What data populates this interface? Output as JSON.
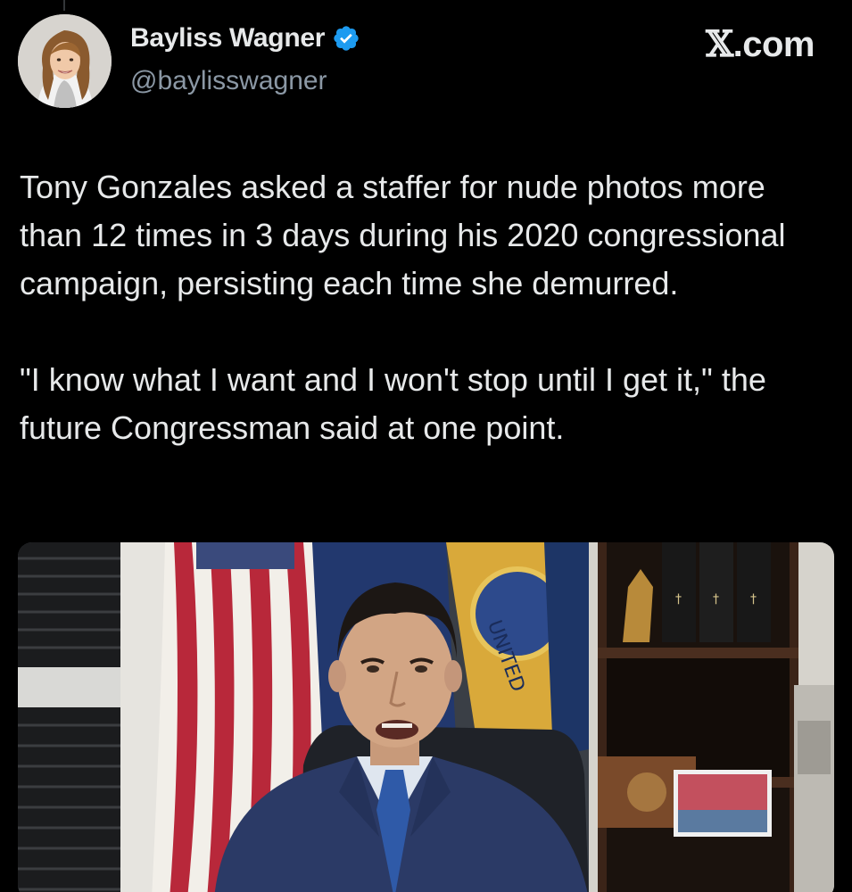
{
  "author": {
    "display_name": "Bayliss Wagner",
    "handle": "@baylisswagner",
    "verified": true,
    "avatar_icon": "profile-photo"
  },
  "brand": {
    "logo_glyph": "𝕏",
    "suffix": ".com"
  },
  "tweet": {
    "paragraphs": [
      "Tony Gonzales asked a staffer for nude photos more than 12 times in 3 days during his 2020 congressional campaign, persisting each time she demurred.",
      "\"I know what I want and I won't stop until I get it,\" the future Congressman said at one point."
    ]
  },
  "media": {
    "type": "video-still"
  },
  "colors": {
    "background": "#000000",
    "primary_text": "#e7e9ea",
    "secondary_text": "#8b98a5",
    "verified_blue": "#1d9bf0"
  }
}
